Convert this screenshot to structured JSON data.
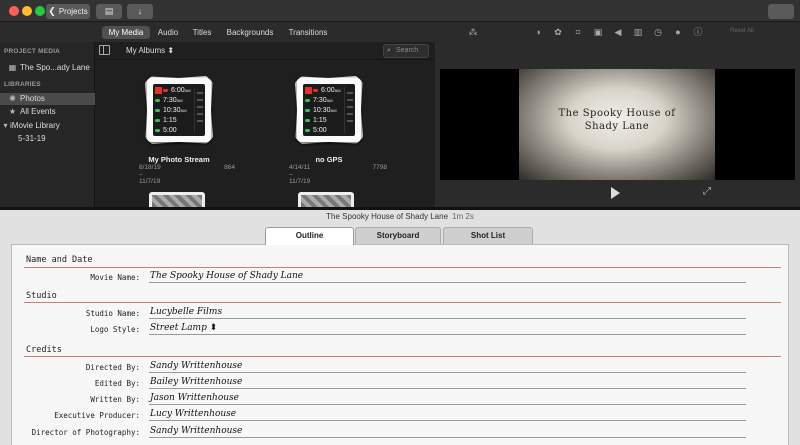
{
  "titlebar": {
    "projects_label": "Projects",
    "projects_chevron": "❮",
    "media_icon": "▤",
    "import_icon": "↓"
  },
  "media_tabs": [
    {
      "label": "My Media",
      "active": true
    },
    {
      "label": "Audio"
    },
    {
      "label": "Titles"
    },
    {
      "label": "Backgrounds"
    },
    {
      "label": "Transitions"
    }
  ],
  "adjust_icons": [
    "magic-wand-icon",
    "color-balance-icon",
    "color-correction-icon",
    "crop-icon",
    "stabilization-icon",
    "volume-icon",
    "equalizer-icon",
    "speed-icon",
    "clip-filter-icon",
    "info-icon"
  ],
  "reset_all": "Reset All",
  "sidebar": {
    "project_media_header": "PROJECT MEDIA",
    "project_item": "The Spo...ady Lane",
    "libraries_header": "LIBRARIES",
    "items": [
      {
        "label": "Photos",
        "selected": true
      },
      {
        "label": "All Events"
      },
      {
        "label": "iMovie Library"
      },
      {
        "label": "5-31-19"
      }
    ]
  },
  "browser": {
    "albums_label": "My Albums",
    "search_placeholder": "Search",
    "albums": [
      {
        "title": "My Photo Stream",
        "dates": "8/18/19 – 11/7/19",
        "count": "864"
      },
      {
        "title": "no GPS",
        "dates": "4/14/11 – 11/7/19",
        "count": "7798"
      }
    ],
    "phone_times": [
      "6:00",
      "7:30",
      "10:30",
      "1:15",
      "5:00"
    ],
    "phone_suffix": "AM"
  },
  "viewer": {
    "title_line1": "The Spooky House of",
    "title_line2": "Shady Lane"
  },
  "project": {
    "title": "The Spooky House of Shady Lane",
    "duration": "1m 2s"
  },
  "lower_tabs": [
    {
      "label": "Outline",
      "active": true
    },
    {
      "label": "Storyboard"
    },
    {
      "label": "Shot List"
    }
  ],
  "outline": {
    "sections": [
      {
        "title": "Name and Date"
      },
      {
        "title": "Studio"
      },
      {
        "title": "Credits"
      }
    ],
    "fields": [
      {
        "label": "Movie Name:",
        "value": "The Spooky House of Shady Lane"
      },
      {
        "label": "Studio Name:",
        "value": "Lucybelle Films"
      },
      {
        "label": "Logo Style:",
        "value": "Street Lamp ⬍"
      },
      {
        "label": "Directed By:",
        "value": "Sandy Writtenhouse"
      },
      {
        "label": "Edited By:",
        "value": "Bailey Writtenhouse"
      },
      {
        "label": "Written By:",
        "value": "Jason Writtenhouse"
      },
      {
        "label": "Executive Producer:",
        "value": "Lucy Writtenhouse"
      },
      {
        "label": "Director of Photography:",
        "value": "Sandy Writtenhouse"
      }
    ]
  },
  "colors": {
    "accent_red": "#e0322f",
    "rule": "#c98074",
    "selected": "#4a4a4a"
  }
}
